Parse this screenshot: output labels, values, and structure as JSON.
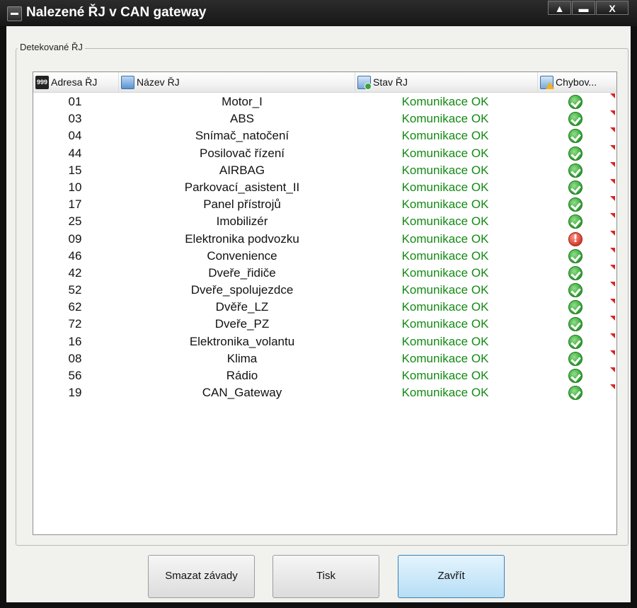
{
  "window": {
    "title": "Nalezené ŘJ v CAN gateway",
    "min_label": "_",
    "restore_label": "▬",
    "close_label": "X"
  },
  "group": {
    "label": "Detekované ŘJ"
  },
  "columns": {
    "address": "Adresa ŘJ",
    "name": "Název ŘJ",
    "state": "Stav ŘJ",
    "errors": "Chybov..."
  },
  "icons": {
    "address_header": "999",
    "ok_status": "check-ok-icon",
    "error_status": "exclamation-error-icon"
  },
  "rows": [
    {
      "addr": "01",
      "name": "Motor_I",
      "state": "Komunikace OK",
      "err": "ok"
    },
    {
      "addr": "03",
      "name": "ABS",
      "state": "Komunikace OK",
      "err": "ok"
    },
    {
      "addr": "04",
      "name": "Snímač_natočení",
      "state": "Komunikace OK",
      "err": "ok"
    },
    {
      "addr": "44",
      "name": "Posilovač řízení",
      "state": "Komunikace OK",
      "err": "ok"
    },
    {
      "addr": "15",
      "name": "AIRBAG",
      "state": "Komunikace OK",
      "err": "ok"
    },
    {
      "addr": "10",
      "name": "Parkovací_asistent_II",
      "state": "Komunikace OK",
      "err": "ok"
    },
    {
      "addr": "17",
      "name": "Panel přístrojů",
      "state": "Komunikace OK",
      "err": "ok"
    },
    {
      "addr": "25",
      "name": "Imobilizér",
      "state": "Komunikace OK",
      "err": "ok"
    },
    {
      "addr": "09",
      "name": "Elektronika podvozku",
      "state": "Komunikace OK",
      "err": "error"
    },
    {
      "addr": "46",
      "name": "Convenience",
      "state": "Komunikace OK",
      "err": "ok"
    },
    {
      "addr": "42",
      "name": "Dveře_řidiče",
      "state": "Komunikace OK",
      "err": "ok"
    },
    {
      "addr": "52",
      "name": "Dveře_spolujezdce",
      "state": "Komunikace OK",
      "err": "ok"
    },
    {
      "addr": "62",
      "name": "Dvěře_LZ",
      "state": "Komunikace OK",
      "err": "ok"
    },
    {
      "addr": "72",
      "name": "Dveře_PZ",
      "state": "Komunikace OK",
      "err": "ok"
    },
    {
      "addr": "16",
      "name": "Elektronika_volantu",
      "state": "Komunikace OK",
      "err": "ok"
    },
    {
      "addr": "08",
      "name": "Klima",
      "state": "Komunikace OK",
      "err": "ok"
    },
    {
      "addr": "56",
      "name": "Rádio",
      "state": "Komunikace OK",
      "err": "ok"
    },
    {
      "addr": "19",
      "name": "CAN_Gateway",
      "state": "Komunikace OK",
      "err": "ok"
    }
  ],
  "buttons": {
    "clear": "Smazat závady",
    "print": "Tisk",
    "close": "Zavřít"
  },
  "colors": {
    "ok_text": "#138a13",
    "primary_button": "#b6def6"
  }
}
